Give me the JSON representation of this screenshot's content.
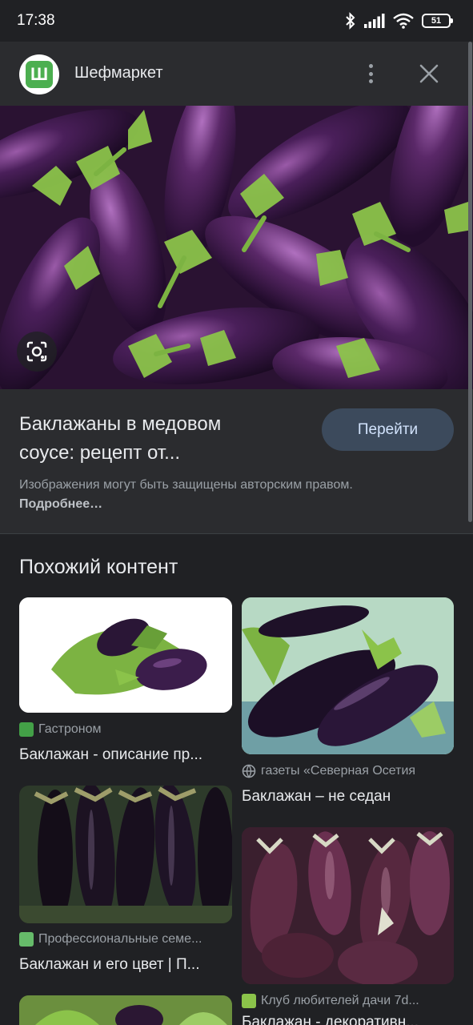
{
  "status": {
    "time": "17:38",
    "battery": "51"
  },
  "header": {
    "site_name": "Шефмаркет",
    "logo_letter": "Ш"
  },
  "result": {
    "title_line1": "Баклажаны в медовом",
    "title_line2": "соусе: рецепт от...",
    "go_label": "Перейти",
    "copyright_text": "Изображения могут быть защищены авторским правом.",
    "more_link": "Подробнее…"
  },
  "similar": {
    "heading": "Похожий контент",
    "cards": [
      {
        "source": "Гастроном",
        "title": "Баклажан - описание пр...",
        "icon_color": "#43a047"
      },
      {
        "source": "газеты «Северная Осетия",
        "title": "Баклажан – не седан",
        "icon_color": "#9aa0a6"
      },
      {
        "source": "Профессиональные семе...",
        "title": "Баклажан и его цвет | П...",
        "icon_color": "#66bb6a"
      },
      {
        "source": "Клуб любителей дачи 7d...",
        "title": "Баклажан - декоративн...",
        "icon_color": "#8bc34a"
      }
    ]
  },
  "colors": {
    "background": "#202124",
    "panel": "#2b2c2f",
    "button": "#3c4a5c",
    "accent_green": "#4caf50"
  }
}
